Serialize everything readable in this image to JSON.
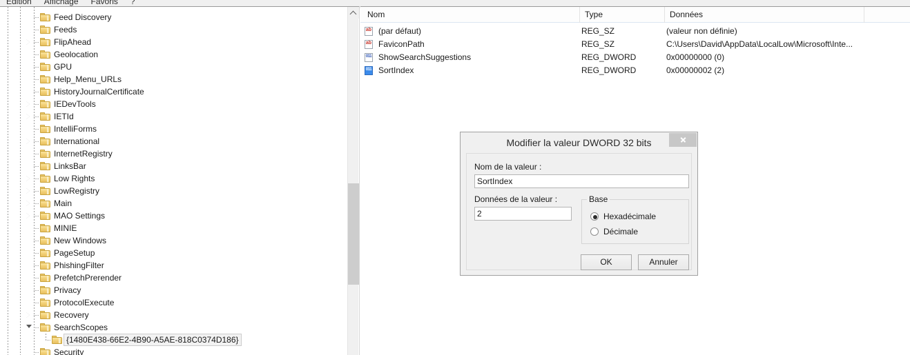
{
  "menubar": {
    "items": [
      {
        "label": "Edition"
      },
      {
        "label": "Affichage"
      },
      {
        "label": "Favoris"
      },
      {
        "label": "?"
      }
    ]
  },
  "tree": {
    "scrollbar": {
      "up_icon": "chevron-up-icon"
    },
    "nodes": [
      {
        "label": "Feed Discovery",
        "expander": "none",
        "indent": 0
      },
      {
        "label": "Feeds",
        "expander": "none",
        "indent": 0
      },
      {
        "label": "FlipAhead",
        "expander": "closed",
        "indent": 0
      },
      {
        "label": "Geolocation",
        "expander": "none",
        "indent": 0
      },
      {
        "label": "GPU",
        "expander": "none",
        "indent": 0
      },
      {
        "label": "Help_Menu_URLs",
        "expander": "none",
        "indent": 0
      },
      {
        "label": "HistoryJournalCertificate",
        "expander": "none",
        "indent": 0
      },
      {
        "label": "IEDevTools",
        "expander": "closed",
        "indent": 0
      },
      {
        "label": "IETId",
        "expander": "closed",
        "indent": 0
      },
      {
        "label": "IntelliForms",
        "expander": "none",
        "indent": 0
      },
      {
        "label": "International",
        "expander": "closed",
        "indent": 0
      },
      {
        "label": "InternetRegistry",
        "expander": "none",
        "indent": 0
      },
      {
        "label": "LinksBar",
        "expander": "none",
        "indent": 0
      },
      {
        "label": "Low Rights",
        "expander": "closed",
        "indent": 0
      },
      {
        "label": "LowRegistry",
        "expander": "closed",
        "indent": 0
      },
      {
        "label": "Main",
        "expander": "closed",
        "indent": 0
      },
      {
        "label": "MAO Settings",
        "expander": "closed",
        "indent": 0
      },
      {
        "label": "MINIE",
        "expander": "none",
        "indent": 0
      },
      {
        "label": "New Windows",
        "expander": "none",
        "indent": 0
      },
      {
        "label": "PageSetup",
        "expander": "none",
        "indent": 0
      },
      {
        "label": "PhishingFilter",
        "expander": "none",
        "indent": 0
      },
      {
        "label": "PrefetchPrerender",
        "expander": "none",
        "indent": 0
      },
      {
        "label": "Privacy",
        "expander": "none",
        "indent": 0
      },
      {
        "label": "ProtocolExecute",
        "expander": "none",
        "indent": 0
      },
      {
        "label": "Recovery",
        "expander": "closed",
        "indent": 0
      },
      {
        "label": "SearchScopes",
        "expander": "open",
        "indent": 0
      },
      {
        "label": "{1480E438-66E2-4B90-A5AE-818C0374D186}",
        "expander": "none",
        "indent": 1,
        "selected": true
      },
      {
        "label": "Security",
        "expander": "none",
        "indent": 0
      }
    ]
  },
  "list": {
    "columns": [
      "Nom",
      "Type",
      "Données",
      ""
    ],
    "rows": [
      {
        "icon": "string-value-icon",
        "name": "(par défaut)",
        "type": "REG_SZ",
        "data": "(valeur non définie)",
        "selected": false
      },
      {
        "icon": "string-value-icon",
        "name": "FaviconPath",
        "type": "REG_SZ",
        "data": "C:\\Users\\David\\AppData\\LocalLow\\Microsoft\\Inte...",
        "selected": false
      },
      {
        "icon": "dword-value-icon",
        "name": "ShowSearchSuggestions",
        "type": "REG_DWORD",
        "data": "0x00000000 (0)",
        "selected": false
      },
      {
        "icon": "dword-value-icon",
        "name": "SortIndex",
        "type": "REG_DWORD",
        "data": "0x00000002 (2)",
        "selected": true
      }
    ]
  },
  "dialog": {
    "title": "Modifier la valeur DWORD 32 bits",
    "close_icon": "close-icon",
    "name_label": "Nom de la valeur :",
    "name_value": "SortIndex",
    "data_label": "Données de la valeur :",
    "data_value": "2",
    "base_group_label": "Base",
    "base_options": [
      {
        "label": "Hexadécimale",
        "selected": true
      },
      {
        "label": "Décimale",
        "selected": false
      }
    ],
    "ok_label": "OK",
    "cancel_label": "Annuler"
  },
  "colors": {
    "selection_blue": "#3b8beb",
    "folder_yellow": "#f3d279",
    "string_icon_red": "#c8342a",
    "dword_icon_blue": "#2a52b5"
  }
}
